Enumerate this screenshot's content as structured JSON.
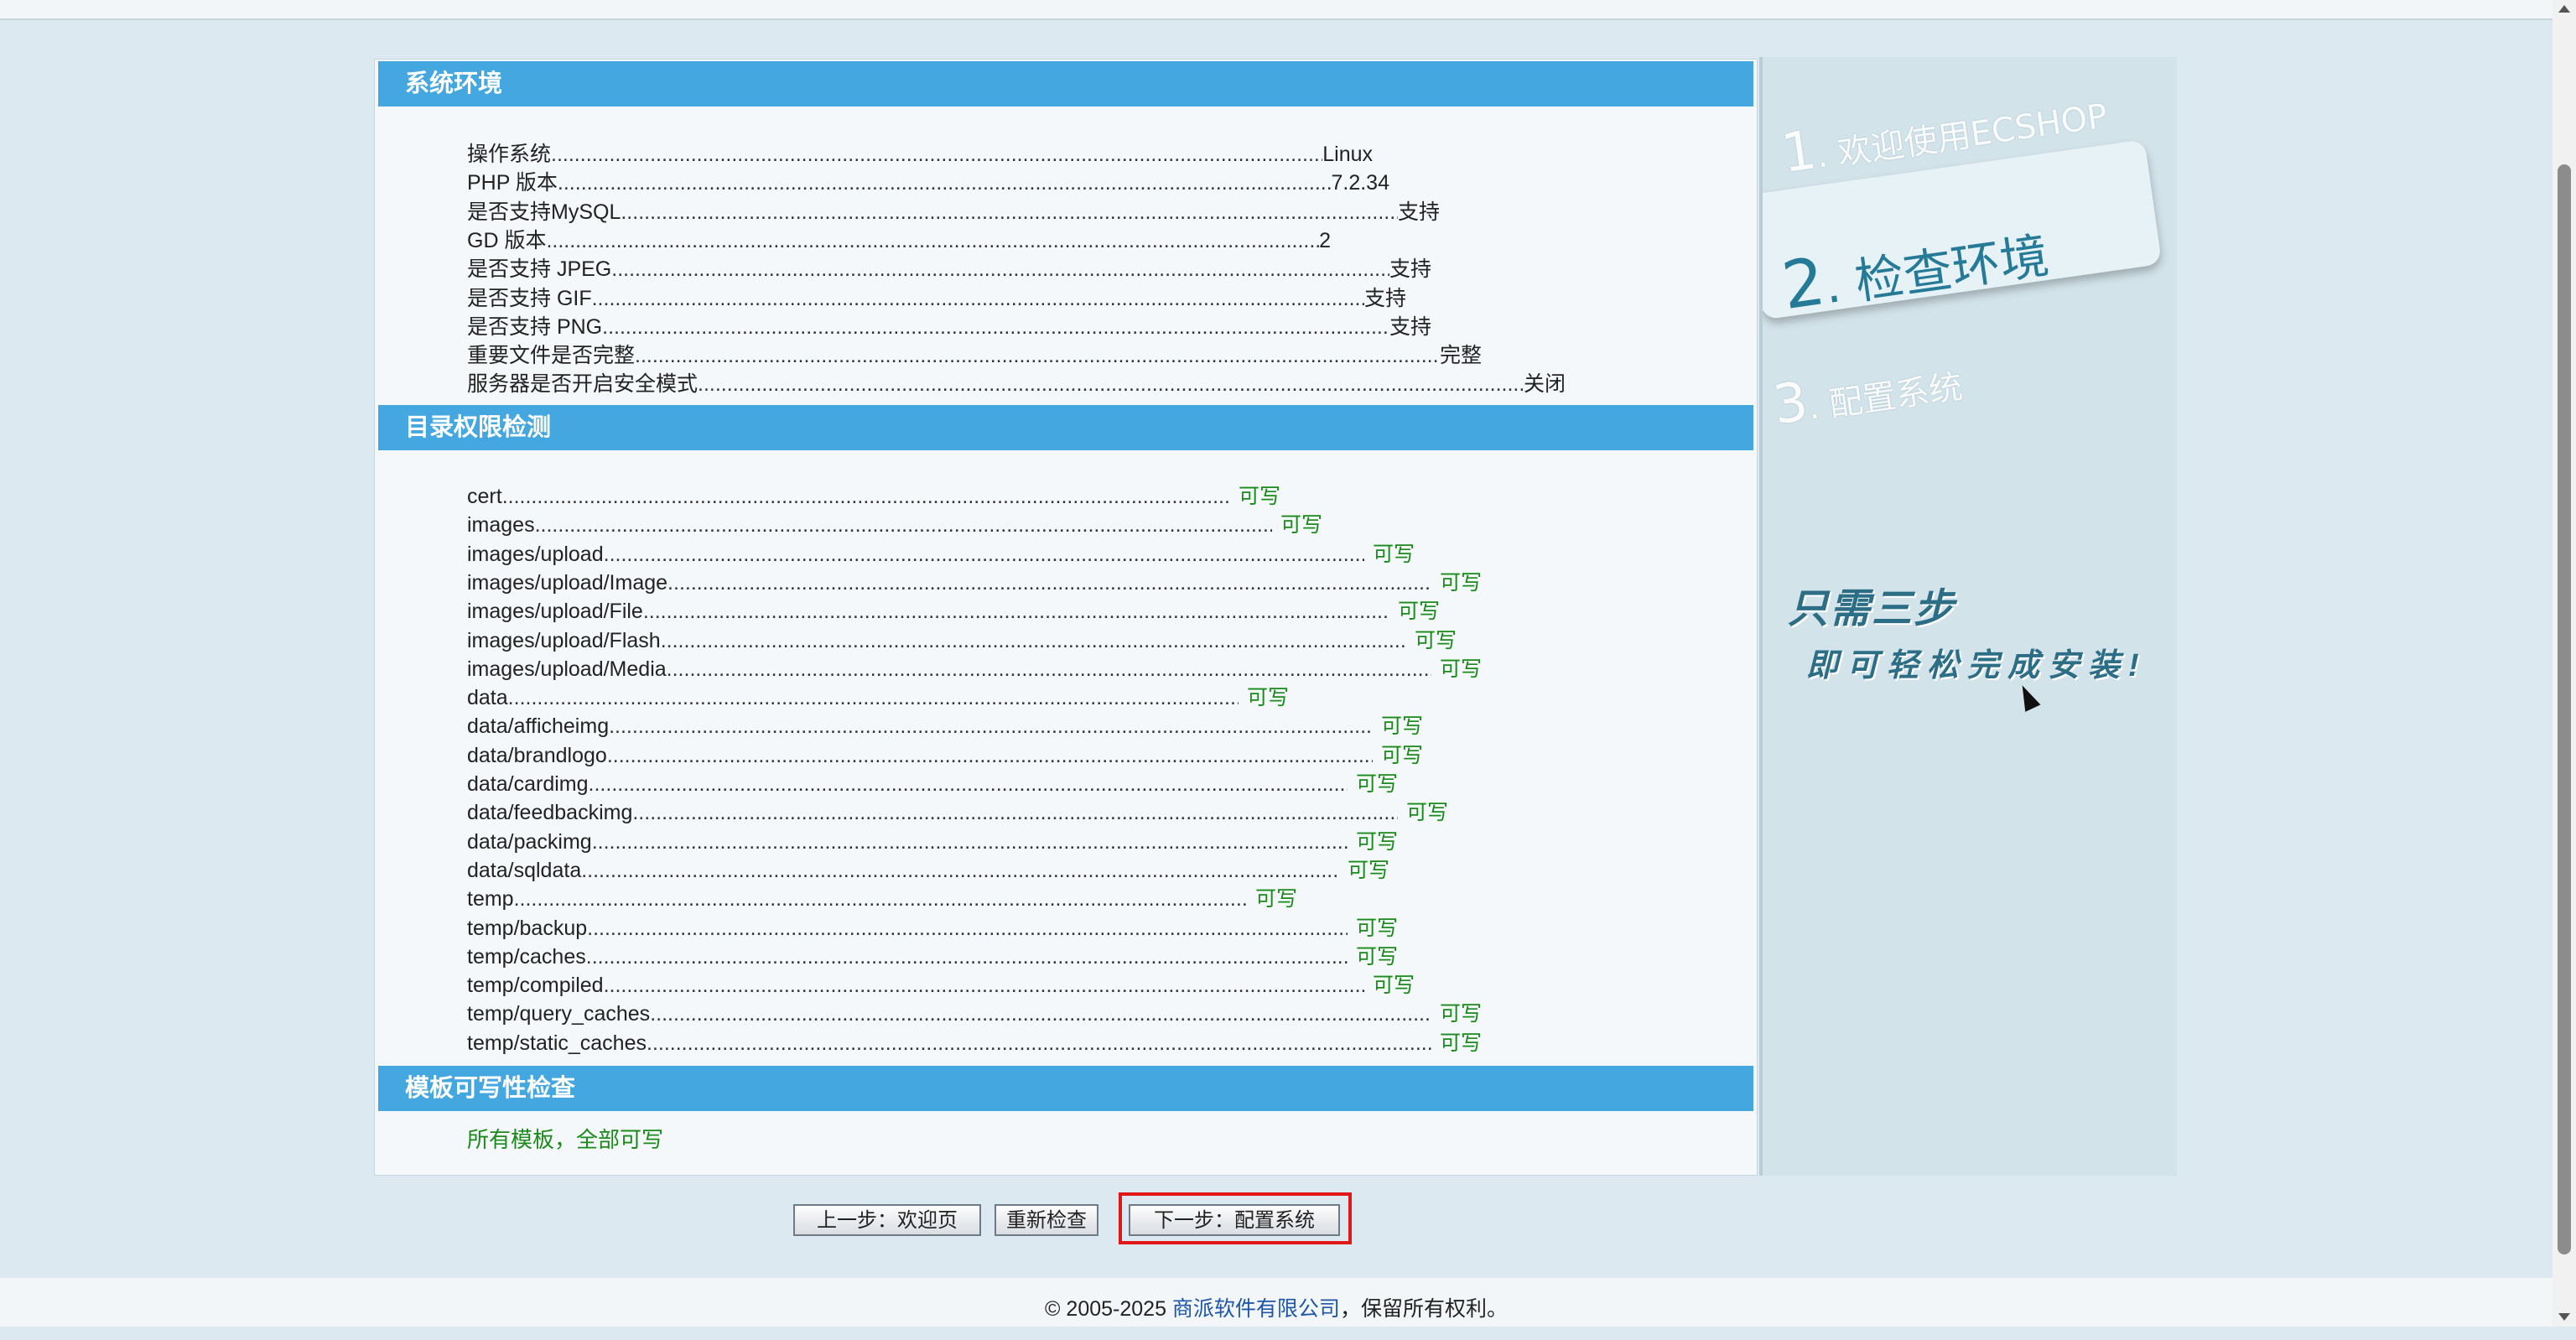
{
  "sections": {
    "system": {
      "title": "系统环境",
      "rows": [
        {
          "label": "操作系统",
          "value": "Linux"
        },
        {
          "label": "PHP 版本",
          "value": "7.2.34"
        },
        {
          "label": "是否支持MySQL",
          "value": "支持"
        },
        {
          "label": "GD 版本",
          "value": "2"
        },
        {
          "label": "是否支持 JPEG",
          "value": "支持"
        },
        {
          "label": "是否支持 GIF",
          "value": "支持"
        },
        {
          "label": "是否支持 PNG",
          "value": "支持"
        },
        {
          "label": "重要文件是否完整",
          "value": "完整"
        },
        {
          "label": "服务器是否开启安全模式",
          "value": "关闭"
        }
      ]
    },
    "dirs": {
      "title": "目录权限检测",
      "rows": [
        {
          "label": "cert",
          "value": "可写"
        },
        {
          "label": "images",
          "value": "可写"
        },
        {
          "label": "images/upload",
          "value": "可写"
        },
        {
          "label": "images/upload/Image",
          "value": "可写"
        },
        {
          "label": "images/upload/File",
          "value": "可写"
        },
        {
          "label": "images/upload/Flash",
          "value": "可写"
        },
        {
          "label": "images/upload/Media",
          "value": "可写"
        },
        {
          "label": "data",
          "value": "可写"
        },
        {
          "label": "data/afficheimg",
          "value": "可写"
        },
        {
          "label": "data/brandlogo",
          "value": "可写"
        },
        {
          "label": "data/cardimg",
          "value": "可写"
        },
        {
          "label": "data/feedbackimg",
          "value": "可写"
        },
        {
          "label": "data/packimg",
          "value": "可写"
        },
        {
          "label": "data/sqldata",
          "value": "可写"
        },
        {
          "label": "temp",
          "value": "可写"
        },
        {
          "label": "temp/backup",
          "value": "可写"
        },
        {
          "label": "temp/caches",
          "value": "可写"
        },
        {
          "label": "temp/compiled",
          "value": "可写"
        },
        {
          "label": "temp/query_caches",
          "value": "可写"
        },
        {
          "label": "temp/static_caches",
          "value": "可写"
        }
      ]
    },
    "templates": {
      "title": "模板可写性检查",
      "result": "所有模板，全部可写"
    }
  },
  "sidebar": {
    "step1": {
      "num": "1",
      "label": ". 欢迎使用ECSHOP"
    },
    "step2": {
      "num": "2",
      "label": ". 检查环境"
    },
    "step3": {
      "num": "3",
      "label": ". 配置系统"
    },
    "slogan_line1": "只需三步",
    "slogan_line2": "即可轻松完成安装!"
  },
  "buttons": {
    "prev": "上一步：欢迎页",
    "recheck": "重新检查",
    "next": "下一步：配置系统"
  },
  "footer": {
    "copyright": "© 2005-2025 ",
    "company": "商派软件有限公司",
    "rights": "，保留所有权利。"
  },
  "colors": {
    "header": "#44a7df",
    "ok": "#1a8a1a",
    "highlight": "#e01818"
  }
}
